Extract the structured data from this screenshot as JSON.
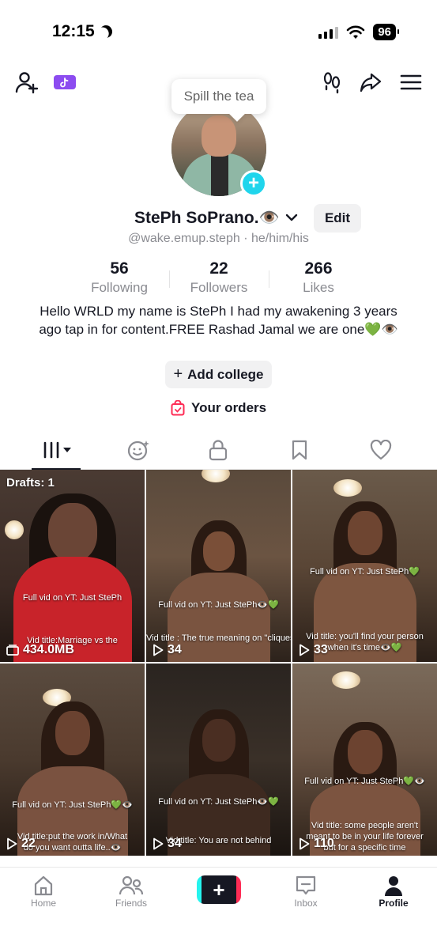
{
  "status_bar": {
    "time": "12:15",
    "battery": "96"
  },
  "tooltip": {
    "text": "Spill the tea"
  },
  "profile": {
    "name": "StePh SoPrano.👁️",
    "edit_label": "Edit",
    "handle": "@wake.emup.steph · he/him/his",
    "stats": [
      {
        "value": "56",
        "label": "Following"
      },
      {
        "value": "22",
        "label": "Followers"
      },
      {
        "value": "266",
        "label": "Likes"
      }
    ],
    "bio": "Hello WRLD my name is StePh I had my awakening  3 years ago tap in for content.FREE Rashad Jamal we are one💚👁️",
    "add_college_label": "Add college",
    "orders_label": "Your orders"
  },
  "videos": [
    {
      "top_label": "Drafts: 1",
      "overlay1": "Full vid on YT: Just StePh",
      "overlay2": "Vid title:Marriage vs the",
      "count": "434.0MB"
    },
    {
      "overlay1": "Full vid on YT: Just StePh👁️💚",
      "overlay2": "Vid title : The true meaning on \"cliques\"💚👁️",
      "count": "34"
    },
    {
      "overlay1": "Full vid on YT: Just StePh💚",
      "overlay2": "Vid title: you'll find your person when it's time👁️💚",
      "count": "33"
    },
    {
      "overlay1": "Full vid on YT: Just StePh💚👁️",
      "overlay2": "Vid title:put the work in/What do you want outta life..👁️",
      "count": "22"
    },
    {
      "overlay1": "Full vid on YT: Just StePh👁️💚",
      "overlay2": "Vid title: You are not behind",
      "count": "34"
    },
    {
      "overlay1": "Full vid on YT: Just StePh💚👁️",
      "overlay2": "Vid title: some people aren't meant to be in your life forever but for a specific time",
      "count": "110"
    }
  ],
  "bottom_nav": [
    {
      "label": "Home",
      "icon": "home-icon"
    },
    {
      "label": "Friends",
      "icon": "friends-icon"
    },
    {
      "label": "",
      "icon": "create-icon"
    },
    {
      "label": "Inbox",
      "icon": "inbox-icon"
    },
    {
      "label": "Profile",
      "icon": "profile-icon"
    }
  ]
}
